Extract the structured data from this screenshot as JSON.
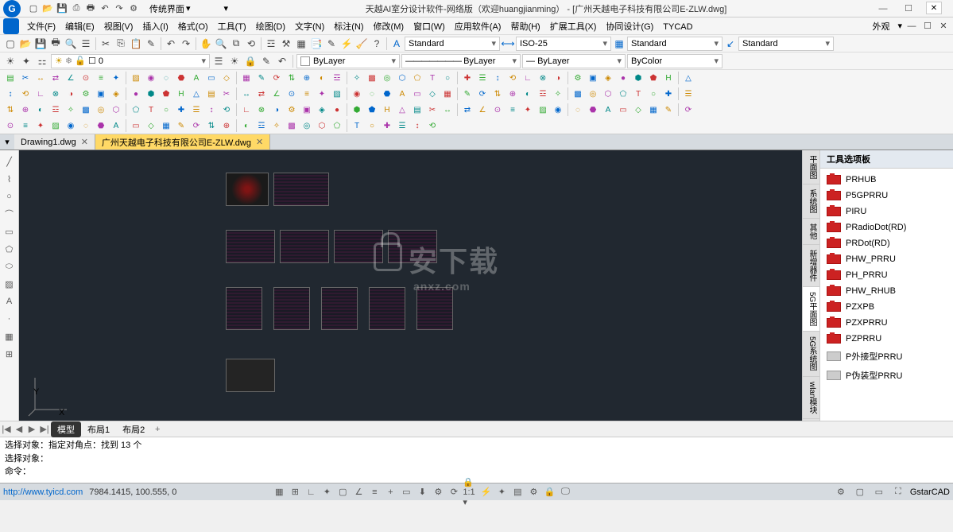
{
  "title": "天越AI室分设计软件-网络版（欢迎huangjianming） - [广州天越电子科技有限公司E-ZLW.dwg]",
  "skin_dd": "传统界面",
  "menus": [
    "文件(F)",
    "编辑(E)",
    "视图(V)",
    "插入(I)",
    "格式(O)",
    "工具(T)",
    "绘图(D)",
    "文字(N)",
    "标注(N)",
    "修改(M)",
    "窗口(W)",
    "应用软件(A)",
    "帮助(H)",
    "扩展工具(X)",
    "协同设计(G)",
    "TYCAD"
  ],
  "menu_right": "外观",
  "style_dd1": "Standard",
  "style_dd2": "ISO-25",
  "style_dd3": "Standard",
  "style_dd4": "Standard",
  "layer_dd": "0",
  "prop": {
    "color": "ByLayer",
    "linetype": "ByLayer",
    "lineweight": "ByLayer",
    "plotstyle": "ByColor"
  },
  "tabs": {
    "inactive": "Drawing1.dwg",
    "active": "广州天越电子科技有限公司E-ZLW.dwg"
  },
  "side_tabs": [
    "平面图",
    "系统图",
    "其他",
    "新增器件",
    "5G平面图",
    "5G系统图",
    "wlan模块"
  ],
  "palette_title": "工具选项板",
  "palette_items": [
    {
      "label": "PRHUB",
      "red": true
    },
    {
      "label": "P5GPRRU",
      "red": true
    },
    {
      "label": "PIRU",
      "red": true
    },
    {
      "label": "PRadioDot(RD)",
      "red": true
    },
    {
      "label": "PRDot(RD)",
      "red": true
    },
    {
      "label": "PHW_PRRU",
      "red": true
    },
    {
      "label": "PH_PRRU",
      "red": true
    },
    {
      "label": "PHW_RHUB",
      "red": true
    },
    {
      "label": "PZXPB",
      "red": true
    },
    {
      "label": "PZXPRRU",
      "red": true
    },
    {
      "label": "PZPRRU",
      "red": true
    },
    {
      "label": "P外接型PRRU",
      "red": false
    },
    {
      "label": "P伪装型PRRU",
      "red": false
    }
  ],
  "layout_tabs": {
    "model": "模型",
    "l1": "布局1",
    "l2": "布局2"
  },
  "cmd": {
    "l1": "选择对象：指定对角点：找到 13 个",
    "l2": "选择对象：",
    "l3": "命令："
  },
  "status": {
    "url": "http://www.tyicd.com",
    "coords": "7984.1415, 100.555, 0",
    "brand": "GstarCAD"
  },
  "axes": {
    "x": "X",
    "y": "Y"
  },
  "watermark": {
    "main": "安下载",
    "sub": "anxz.com"
  }
}
